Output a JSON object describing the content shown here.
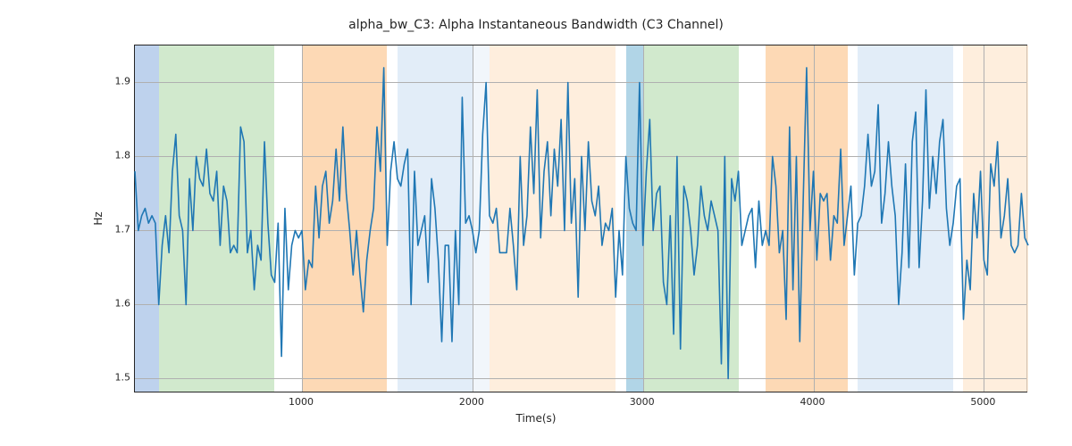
{
  "chart_data": {
    "type": "line",
    "title": "alpha_bw_C3: Alpha Instantaneous Bandwidth (C3 Channel)",
    "xlabel": "Time(s)",
    "ylabel": "Hz",
    "xlim": [
      20,
      5260
    ],
    "ylim": [
      1.48,
      1.95
    ],
    "x_ticks": [
      1000,
      2000,
      3000,
      4000,
      5000
    ],
    "y_ticks": [
      1.5,
      1.6,
      1.7,
      1.8,
      1.9
    ],
    "background_spans": [
      {
        "start": 20,
        "end": 160,
        "color": "#aec7e8",
        "alpha": 0.8
      },
      {
        "start": 160,
        "end": 840,
        "color": "#c6e3c0",
        "alpha": 0.8
      },
      {
        "start": 840,
        "end": 1000,
        "color": "#ffffff",
        "alpha": 0.0
      },
      {
        "start": 1000,
        "end": 1500,
        "color": "#fdd0a2",
        "alpha": 0.8
      },
      {
        "start": 1500,
        "end": 1560,
        "color": "#ffffff",
        "alpha": 0.0
      },
      {
        "start": 1560,
        "end": 2000,
        "color": "#dbe9f6",
        "alpha": 0.8
      },
      {
        "start": 2000,
        "end": 2100,
        "color": "#dbe9f6",
        "alpha": 0.4
      },
      {
        "start": 2100,
        "end": 2840,
        "color": "#feead5",
        "alpha": 0.8
      },
      {
        "start": 2840,
        "end": 2900,
        "color": "#ffffff",
        "alpha": 0.0
      },
      {
        "start": 2900,
        "end": 3000,
        "color": "#9ecae1",
        "alpha": 0.8
      },
      {
        "start": 3000,
        "end": 3560,
        "color": "#c6e3c0",
        "alpha": 0.8
      },
      {
        "start": 3560,
        "end": 3720,
        "color": "#ffffff",
        "alpha": 0.0
      },
      {
        "start": 3720,
        "end": 4200,
        "color": "#fdd0a2",
        "alpha": 0.8
      },
      {
        "start": 4200,
        "end": 4260,
        "color": "#ffffff",
        "alpha": 0.0
      },
      {
        "start": 4260,
        "end": 4820,
        "color": "#dbe9f6",
        "alpha": 0.8
      },
      {
        "start": 4820,
        "end": 4880,
        "color": "#ffffff",
        "alpha": 0.0
      },
      {
        "start": 4880,
        "end": 5260,
        "color": "#feead5",
        "alpha": 0.8
      }
    ],
    "x": [
      20,
      40,
      60,
      80,
      100,
      120,
      140,
      160,
      180,
      200,
      220,
      240,
      260,
      280,
      300,
      320,
      340,
      360,
      380,
      400,
      420,
      440,
      460,
      480,
      500,
      520,
      540,
      560,
      580,
      600,
      620,
      640,
      660,
      680,
      700,
      720,
      740,
      760,
      780,
      800,
      820,
      840,
      860,
      880,
      900,
      920,
      940,
      960,
      980,
      1000,
      1020,
      1040,
      1060,
      1080,
      1100,
      1120,
      1140,
      1160,
      1180,
      1200,
      1220,
      1240,
      1260,
      1280,
      1300,
      1320,
      1340,
      1360,
      1380,
      1400,
      1420,
      1440,
      1460,
      1480,
      1500,
      1520,
      1540,
      1560,
      1580,
      1600,
      1620,
      1640,
      1660,
      1680,
      1700,
      1720,
      1740,
      1760,
      1780,
      1800,
      1820,
      1840,
      1860,
      1880,
      1900,
      1920,
      1940,
      1960,
      1980,
      2000,
      2020,
      2040,
      2060,
      2080,
      2100,
      2120,
      2140,
      2160,
      2180,
      2200,
      2220,
      2240,
      2260,
      2280,
      2300,
      2320,
      2340,
      2360,
      2380,
      2400,
      2420,
      2440,
      2460,
      2480,
      2500,
      2520,
      2540,
      2560,
      2580,
      2600,
      2620,
      2640,
      2660,
      2680,
      2700,
      2720,
      2740,
      2760,
      2780,
      2800,
      2820,
      2840,
      2860,
      2880,
      2900,
      2920,
      2940,
      2960,
      2980,
      3000,
      3020,
      3040,
      3060,
      3080,
      3100,
      3120,
      3140,
      3160,
      3180,
      3200,
      3220,
      3240,
      3260,
      3280,
      3300,
      3320,
      3340,
      3360,
      3380,
      3400,
      3420,
      3440,
      3460,
      3480,
      3500,
      3520,
      3540,
      3560,
      3580,
      3600,
      3620,
      3640,
      3660,
      3680,
      3700,
      3720,
      3740,
      3760,
      3780,
      3800,
      3820,
      3840,
      3860,
      3880,
      3900,
      3920,
      3940,
      3960,
      3980,
      4000,
      4020,
      4040,
      4060,
      4080,
      4100,
      4120,
      4140,
      4160,
      4180,
      4200,
      4220,
      4240,
      4260,
      4280,
      4300,
      4320,
      4340,
      4360,
      4380,
      4400,
      4420,
      4440,
      4460,
      4480,
      4500,
      4520,
      4540,
      4560,
      4580,
      4600,
      4620,
      4640,
      4660,
      4680,
      4700,
      4720,
      4740,
      4760,
      4780,
      4800,
      4820,
      4840,
      4860,
      4880,
      4900,
      4920,
      4940,
      4960,
      4980,
      5000,
      5020,
      5040,
      5060,
      5080,
      5100,
      5120,
      5140,
      5160,
      5180,
      5200,
      5220,
      5240,
      5260
    ],
    "values": [
      1.78,
      1.7,
      1.72,
      1.73,
      1.71,
      1.72,
      1.71,
      1.6,
      1.68,
      1.72,
      1.67,
      1.78,
      1.83,
      1.72,
      1.7,
      1.6,
      1.77,
      1.7,
      1.8,
      1.77,
      1.76,
      1.81,
      1.75,
      1.74,
      1.78,
      1.68,
      1.76,
      1.74,
      1.67,
      1.68,
      1.67,
      1.84,
      1.82,
      1.67,
      1.7,
      1.62,
      1.68,
      1.66,
      1.82,
      1.71,
      1.64,
      1.63,
      1.71,
      1.53,
      1.73,
      1.62,
      1.68,
      1.7,
      1.69,
      1.7,
      1.62,
      1.66,
      1.65,
      1.76,
      1.69,
      1.76,
      1.78,
      1.71,
      1.74,
      1.81,
      1.74,
      1.84,
      1.75,
      1.7,
      1.64,
      1.7,
      1.64,
      1.59,
      1.66,
      1.7,
      1.73,
      1.84,
      1.78,
      1.92,
      1.68,
      1.78,
      1.82,
      1.77,
      1.76,
      1.79,
      1.81,
      1.6,
      1.78,
      1.68,
      1.7,
      1.72,
      1.63,
      1.77,
      1.73,
      1.66,
      1.55,
      1.68,
      1.68,
      1.55,
      1.7,
      1.6,
      1.88,
      1.71,
      1.72,
      1.7,
      1.67,
      1.7,
      1.83,
      1.9,
      1.72,
      1.71,
      1.73,
      1.67,
      1.67,
      1.67,
      1.73,
      1.68,
      1.62,
      1.8,
      1.68,
      1.72,
      1.84,
      1.75,
      1.89,
      1.69,
      1.78,
      1.82,
      1.72,
      1.81,
      1.76,
      1.85,
      1.7,
      1.9,
      1.71,
      1.77,
      1.61,
      1.8,
      1.7,
      1.82,
      1.74,
      1.72,
      1.76,
      1.68,
      1.71,
      1.7,
      1.73,
      1.61,
      1.7,
      1.64,
      1.8,
      1.73,
      1.71,
      1.7,
      1.9,
      1.68,
      1.78,
      1.85,
      1.7,
      1.75,
      1.76,
      1.63,
      1.6,
      1.72,
      1.56,
      1.8,
      1.54,
      1.76,
      1.74,
      1.7,
      1.64,
      1.68,
      1.76,
      1.72,
      1.7,
      1.74,
      1.72,
      1.7,
      1.52,
      1.8,
      1.5,
      1.77,
      1.74,
      1.78,
      1.68,
      1.7,
      1.72,
      1.73,
      1.65,
      1.74,
      1.68,
      1.7,
      1.68,
      1.8,
      1.76,
      1.67,
      1.7,
      1.58,
      1.84,
      1.62,
      1.8,
      1.55,
      1.74,
      1.92,
      1.7,
      1.78,
      1.66,
      1.75,
      1.74,
      1.75,
      1.66,
      1.72,
      1.71,
      1.81,
      1.68,
      1.72,
      1.76,
      1.64,
      1.71,
      1.72,
      1.76,
      1.83,
      1.76,
      1.78,
      1.87,
      1.71,
      1.75,
      1.82,
      1.76,
      1.72,
      1.6,
      1.67,
      1.79,
      1.65,
      1.82,
      1.86,
      1.65,
      1.74,
      1.89,
      1.73,
      1.8,
      1.75,
      1.82,
      1.85,
      1.73,
      1.68,
      1.71,
      1.76,
      1.77,
      1.58,
      1.66,
      1.62,
      1.75,
      1.69,
      1.78,
      1.66,
      1.64,
      1.79,
      1.76,
      1.82,
      1.69,
      1.72,
      1.77,
      1.68,
      1.67,
      1.68,
      1.75,
      1.69,
      1.68
    ]
  }
}
